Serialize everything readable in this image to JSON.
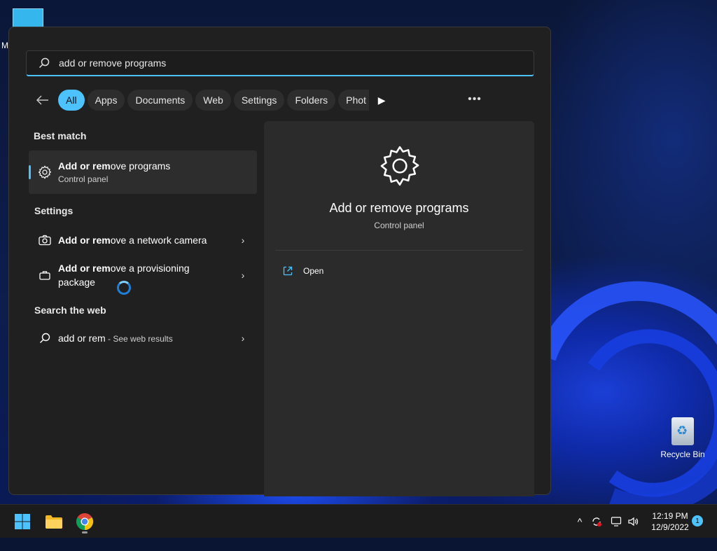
{
  "desktop": {
    "partial_label": "M",
    "recycle_bin_label": "Recycle Bin"
  },
  "search": {
    "query": "add or remove programs",
    "filters": [
      "All",
      "Apps",
      "Documents",
      "Web",
      "Settings",
      "Folders",
      "Phot"
    ],
    "active_filter": "All"
  },
  "results": {
    "best_match_heading": "Best match",
    "best_match": {
      "title_bold": "Add or rem",
      "title_rest": "ove programs",
      "subtitle": "Control panel"
    },
    "settings_heading": "Settings",
    "settings_items": [
      {
        "title_bold": "Add or rem",
        "title_rest": "ove a network camera"
      },
      {
        "title_bold": "Add or rem",
        "title_rest": "ove a provisioning",
        "title_line2": "package"
      }
    ],
    "web_heading": "Search the web",
    "web_item": {
      "query": "add or rem",
      "suffix": " - See web results"
    }
  },
  "preview": {
    "title": "Add or remove programs",
    "subtitle": "Control panel",
    "action_open": "Open"
  },
  "taskbar": {
    "time": "12:19 PM",
    "date": "12/9/2022",
    "notification_count": "1"
  },
  "colors": {
    "accent": "#4cc2ff",
    "menu_bg": "#202020",
    "preview_bg": "#2b2b2b"
  }
}
